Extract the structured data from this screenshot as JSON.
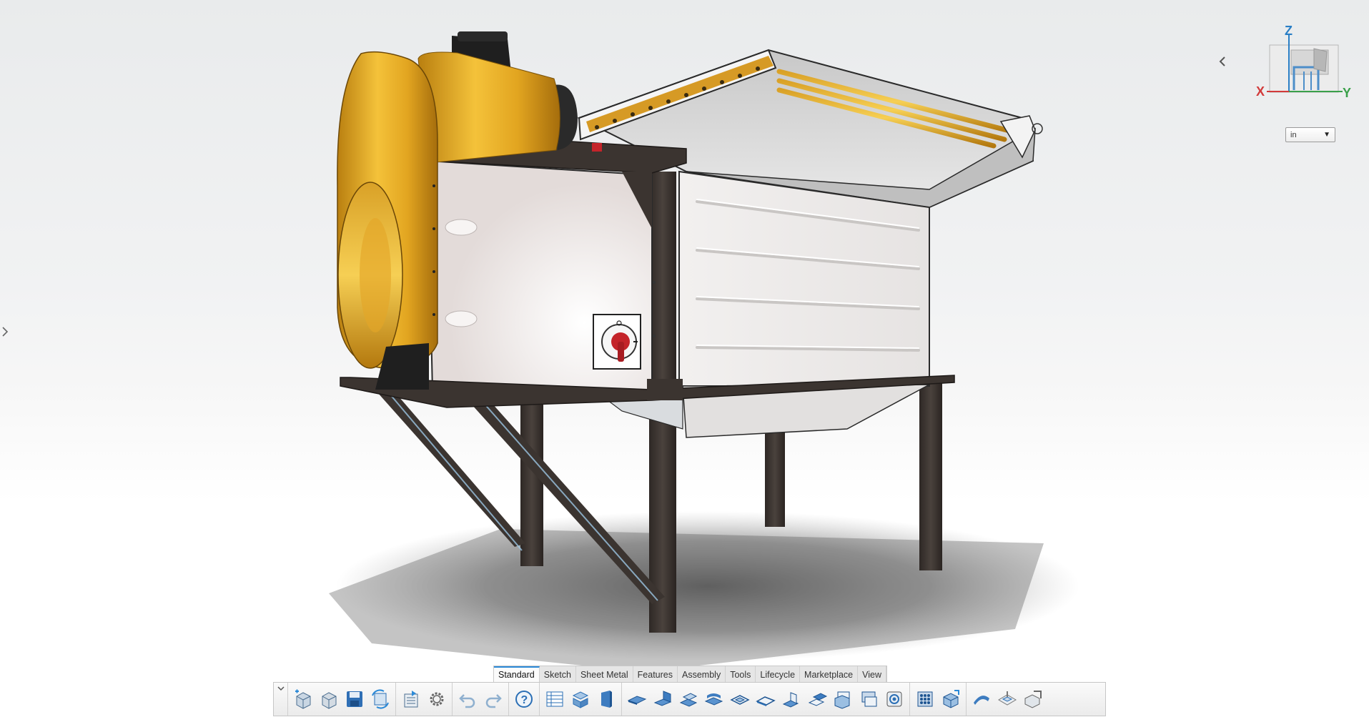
{
  "viewport": {
    "units": {
      "selected": "in"
    },
    "view_cube": {
      "axis_x": "X",
      "axis_y": "Y",
      "axis_z": "Z"
    }
  },
  "toolbar": {
    "tabs": [
      {
        "label": "Standard",
        "active": true
      },
      {
        "label": "Sketch"
      },
      {
        "label": "Sheet Metal"
      },
      {
        "label": "Features"
      },
      {
        "label": "Assembly"
      },
      {
        "label": "Tools"
      },
      {
        "label": "Lifecycle"
      },
      {
        "label": "Marketplace"
      },
      {
        "label": "View"
      }
    ],
    "groups": [
      [
        "new-part-icon",
        "open-file-icon",
        "save-icon",
        "regenerate-icon"
      ],
      [
        "properties-icon",
        "settings-gear-icon"
      ],
      [
        "undo-icon",
        "redo-icon"
      ],
      [
        "help-icon"
      ],
      [
        "bill-of-materials-icon",
        "exploded-view-icon",
        "sheet-metal-door-icon"
      ],
      [
        "base-flange-icon",
        "edge-flange-icon",
        "sketched-bend-icon",
        "hem-icon",
        "jog-icon",
        "lofted-bend-icon",
        "break-corner-icon",
        "miter-flange-icon",
        "unfold-icon",
        "fold-icon",
        "forming-tool-icon"
      ],
      [
        "pattern-icon",
        "insert-bends-icon"
      ],
      [
        "flatten-icon",
        "form-feature-icon",
        "convert-to-sheet-metal-icon"
      ]
    ]
  },
  "colors": {
    "accent_blue": "#2b8ad8",
    "axis_x": "#d23a3a",
    "axis_y": "#3aa04a",
    "axis_z": "#2a7fc6",
    "frame_steel": "#3b3430",
    "gold_motor": "#e0a322",
    "panel_white": "#efeceb"
  }
}
